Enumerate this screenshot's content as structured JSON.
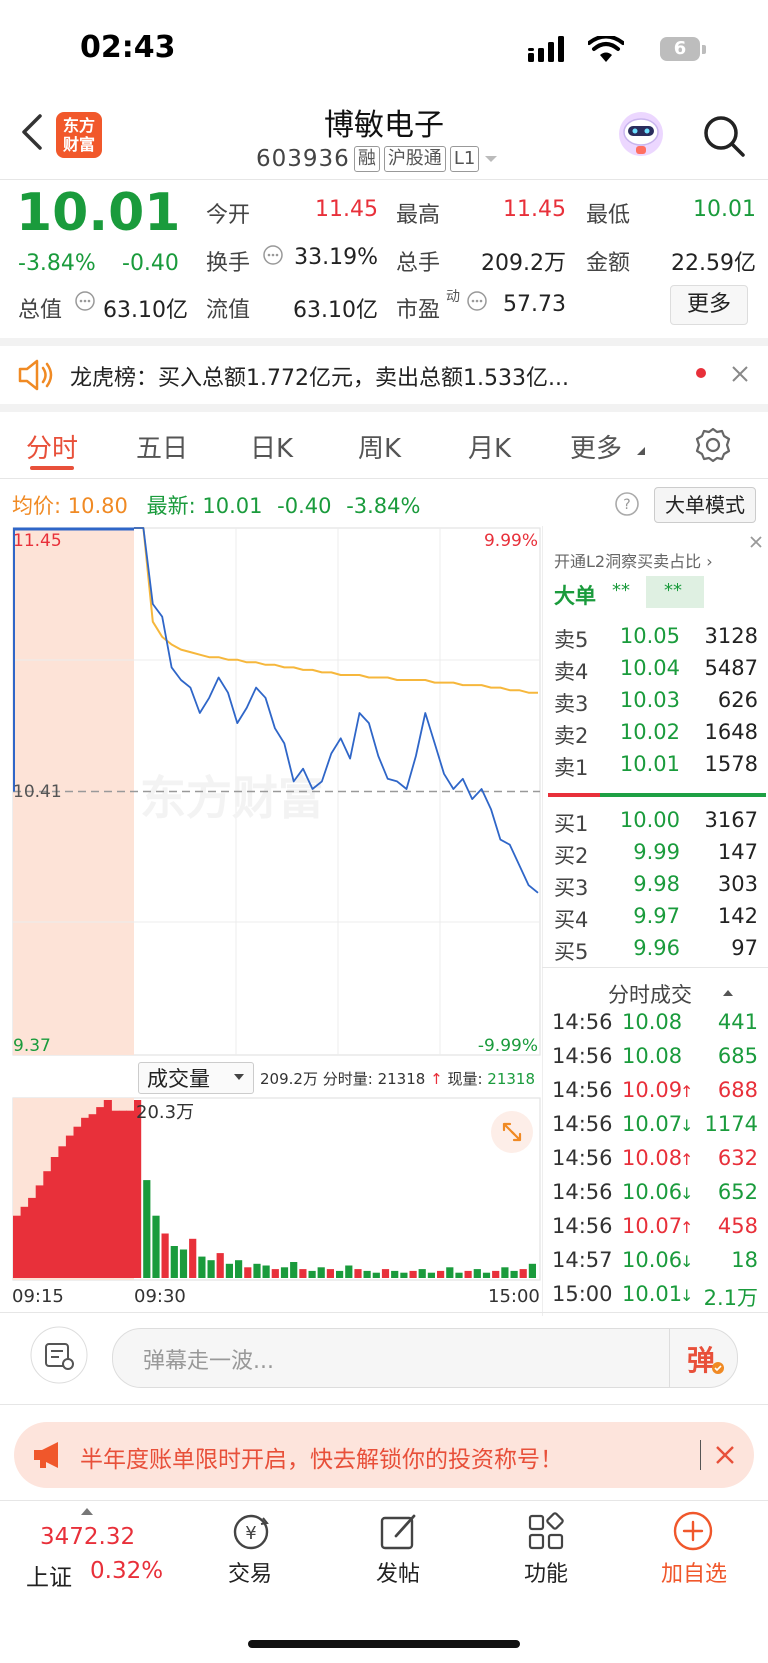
{
  "status_bar": {
    "time": "02:43",
    "battery": "6"
  },
  "header": {
    "logo_line1": "东方",
    "logo_line2": "财富",
    "stock_name": "博敏电子",
    "stock_code": "603936",
    "tags": [
      "融",
      "沪股通",
      "L1"
    ]
  },
  "quote": {
    "price": "10.01",
    "change_pct": "-3.84%",
    "change": "-0.40",
    "open_label": "今开",
    "open": "11.45",
    "high_label": "最高",
    "high": "11.45",
    "low_label": "最低",
    "low": "10.01",
    "turnover_label": "换手",
    "turnover": "33.19%",
    "volume_label": "总手",
    "volume": "209.2万",
    "amount_label": "金额",
    "amount": "22.59亿",
    "mktcap_label": "总值",
    "mktcap": "63.10亿",
    "float_label": "流值",
    "float": "63.10亿",
    "pe_label": "市盈",
    "pe_sup": "动",
    "pe": "57.73",
    "more": "更多"
  },
  "notice": {
    "text": "龙虎榜：买入总额1.772亿元，卖出总额1.533亿..."
  },
  "tabs": [
    "分时",
    "五日",
    "日K",
    "周K",
    "月K",
    "更多"
  ],
  "chart_legend": {
    "avg_label": "均价:",
    "avg": "10.80",
    "last_label": "最新:",
    "last": "10.01",
    "last_chg": "-0.40",
    "last_pct": "-3.84%",
    "mode_button": "大单模式"
  },
  "chart_data": {
    "type": "line",
    "y_high_label": "11.45",
    "y_mid_label": "10.41",
    "y_low_label": "9.37",
    "pct_high_label": "9.99%",
    "pct_low_label": "-9.99%",
    "ylim": [
      9.37,
      11.45
    ],
    "prev_close": 10.41,
    "x_labels": [
      "09:15",
      "09:30",
      "15:00"
    ],
    "watermark": "东方财富",
    "series": [
      {
        "values": [
          11.45,
          11.45,
          11.15,
          11.1,
          10.9,
          10.85,
          10.82,
          10.72,
          10.78,
          10.86,
          10.8,
          10.68,
          10.74,
          10.82,
          10.78,
          10.66,
          10.6,
          10.45,
          10.5,
          10.42,
          10.45,
          10.56,
          10.62,
          10.54,
          10.72,
          10.68,
          10.55,
          10.46,
          10.45,
          10.42,
          10.55,
          10.72,
          10.6,
          10.48,
          10.42,
          10.46,
          10.38,
          10.42,
          10.34,
          10.22,
          10.2,
          10.12,
          10.04,
          10.01
        ]
      },
      {
        "values": [
          11.45,
          11.45,
          11.08,
          11.02,
          10.99,
          10.97,
          10.96,
          10.95,
          10.94,
          10.94,
          10.93,
          10.93,
          10.92,
          10.92,
          10.91,
          10.91,
          10.9,
          10.9,
          10.89,
          10.89,
          10.88,
          10.88,
          10.87,
          10.87,
          10.87,
          10.86,
          10.86,
          10.86,
          10.85,
          10.85,
          10.85,
          10.85,
          10.84,
          10.84,
          10.84,
          10.83,
          10.83,
          10.83,
          10.82,
          10.82,
          10.81,
          10.81,
          10.8,
          10.8
        ]
      }
    ]
  },
  "volume_panel": {
    "selector": "成交量",
    "total": "209.2万",
    "minute_label": "分时量:",
    "minute": "21318",
    "current_label": "现量:",
    "current": "21318",
    "max_label": "20.3万",
    "auction_fill": [
      0.35,
      0.4,
      0.45,
      0.52,
      0.6,
      0.68,
      0.74,
      0.8,
      0.85,
      0.9,
      0.92,
      0.96,
      1.0,
      0.94,
      0.94,
      0.94
    ],
    "bars": [
      1.0,
      0.55,
      0.35,
      0.25,
      0.18,
      0.16,
      0.22,
      0.12,
      0.1,
      0.14,
      0.08,
      0.1,
      0.06,
      0.08,
      0.07,
      0.05,
      0.06,
      0.09,
      0.05,
      0.04,
      0.06,
      0.05,
      0.04,
      0.07,
      0.05,
      0.04,
      0.03,
      0.05,
      0.04,
      0.03,
      0.04,
      0.05,
      0.03,
      0.04,
      0.06,
      0.03,
      0.04,
      0.05,
      0.03,
      0.04,
      0.06,
      0.04,
      0.05,
      0.08
    ]
  },
  "order_book": {
    "l2_prompt": "开通L2洞察买卖占比",
    "big_label": "大单",
    "big_v1": "**",
    "big_v2": "**",
    "asks": [
      {
        "label": "卖5",
        "price": "10.05",
        "vol": "3128"
      },
      {
        "label": "卖4",
        "price": "10.04",
        "vol": "5487"
      },
      {
        "label": "卖3",
        "price": "10.03",
        "vol": "626"
      },
      {
        "label": "卖2",
        "price": "10.02",
        "vol": "1648"
      },
      {
        "label": "卖1",
        "price": "10.01",
        "vol": "1578"
      }
    ],
    "bids": [
      {
        "label": "买1",
        "price": "10.00",
        "vol": "3167"
      },
      {
        "label": "买2",
        "price": "9.99",
        "vol": "147"
      },
      {
        "label": "买3",
        "price": "9.98",
        "vol": "303"
      },
      {
        "label": "买4",
        "price": "9.97",
        "vol": "142"
      },
      {
        "label": "买5",
        "price": "9.96",
        "vol": "97"
      }
    ],
    "ticks_title": "分时成交",
    "ticks": [
      {
        "time": "14:56",
        "price": "10.08",
        "arrow": "",
        "vol": "441"
      },
      {
        "time": "14:56",
        "price": "10.08",
        "arrow": "",
        "vol": "685"
      },
      {
        "time": "14:56",
        "price": "10.09",
        "arrow": "↑",
        "vol": "688"
      },
      {
        "time": "14:56",
        "price": "10.07",
        "arrow": "↓",
        "vol": "1174"
      },
      {
        "time": "14:56",
        "price": "10.08",
        "arrow": "↑",
        "vol": "632"
      },
      {
        "time": "14:56",
        "price": "10.06",
        "arrow": "↓",
        "vol": "652"
      },
      {
        "time": "14:56",
        "price": "10.07",
        "arrow": "↑",
        "vol": "458"
      },
      {
        "time": "14:57",
        "price": "10.06",
        "arrow": "↓",
        "vol": "18"
      },
      {
        "time": "15:00",
        "price": "10.01",
        "arrow": "↓",
        "vol": "2.1万"
      }
    ]
  },
  "danmu": {
    "placeholder": "弹幕走一波...",
    "send": "弹"
  },
  "banner": {
    "text": "半年度账单限时开启，快去解锁你的投资称号！"
  },
  "bottom_nav": {
    "index_value": "3472.32",
    "index_name": "上证",
    "index_pct": "0.32%",
    "items": [
      "交易",
      "发帖",
      "功能",
      "加自选"
    ]
  },
  "colors": {
    "up": "#e8303a",
    "down": "#1a9b3c",
    "price_line": "#2f66c8",
    "avg_line": "#f6b73c",
    "accent": "#f08a24"
  }
}
